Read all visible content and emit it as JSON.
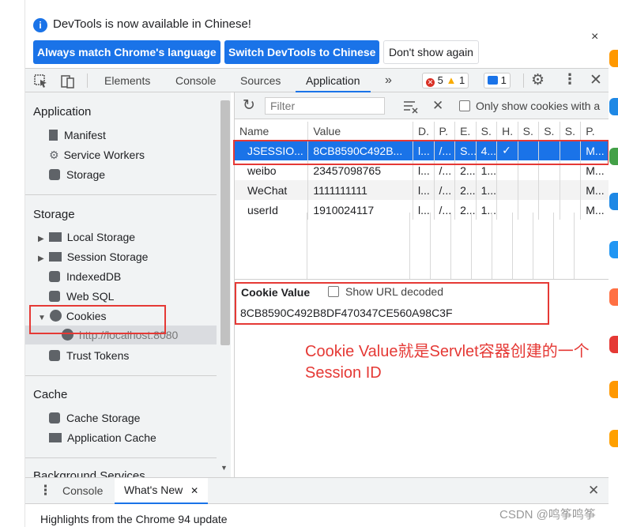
{
  "infobar": {
    "message": "DevTools is now available in Chinese!",
    "btn_match": "Always match Chrome's language",
    "btn_switch": "Switch DevTools to Chinese",
    "btn_dont": "Don't show again",
    "close": "×"
  },
  "tabs": {
    "elements": "Elements",
    "console": "Console",
    "sources": "Sources",
    "application": "Application",
    "more": "»",
    "errors": "5",
    "warnings": "1",
    "messages": "1"
  },
  "sidebar": {
    "application_head": "Application",
    "manifest": "Manifest",
    "service_workers": "Service Workers",
    "storage_item": "Storage",
    "storage_head": "Storage",
    "local_storage": "Local Storage",
    "session_storage": "Session Storage",
    "indexeddb": "IndexedDB",
    "web_sql": "Web SQL",
    "cookies": "Cookies",
    "cookie_origin": "http://localhost:8080",
    "trust_tokens": "Trust Tokens",
    "cache_head": "Cache",
    "cache_storage": "Cache Storage",
    "application_cache": "Application Cache",
    "background_services": "Background Services"
  },
  "filterbar": {
    "placeholder": "Filter",
    "only_issues": "Only show cookies with a"
  },
  "table": {
    "headers": [
      "Name",
      "Value",
      "D.",
      "P.",
      "E.",
      "S.",
      "H.",
      "S.",
      "S.",
      "S.",
      "P."
    ],
    "rows": [
      [
        "JSESSIO...",
        "8CB8590C492B...",
        "l...",
        "/...",
        "S...",
        "4...",
        "✓",
        "",
        "",
        "",
        "M..."
      ],
      [
        "weibo",
        "23457098765",
        "l...",
        "/...",
        "2...",
        "1...",
        "",
        "",
        "",
        "",
        "M..."
      ],
      [
        "WeChat",
        "1111111111",
        "l...",
        "/...",
        "2...",
        "1...",
        "",
        "",
        "",
        "",
        "M..."
      ],
      [
        "userId",
        "1910024117",
        "l...",
        "/...",
        "2...",
        "1...",
        "",
        "",
        "",
        "",
        "M..."
      ]
    ]
  },
  "cookie_value": {
    "label": "Cookie Value",
    "show_decoded": "Show URL decoded",
    "value": "8CB8590C492B8DF470347CE560A98C3F"
  },
  "annotation": {
    "line1": "Cookie Value就是Servlet容器创建的一个",
    "line2": "Session ID"
  },
  "drawer": {
    "console": "Console",
    "whats_new": "What's New",
    "highlights": "Highlights from the Chrome 94 update"
  },
  "watermark": "CSDN @鸣筝鸣筝",
  "colors": {
    "accent": "#1a73e8",
    "annotation": "#e53935",
    "panel_bg": "#f1f3f4"
  }
}
